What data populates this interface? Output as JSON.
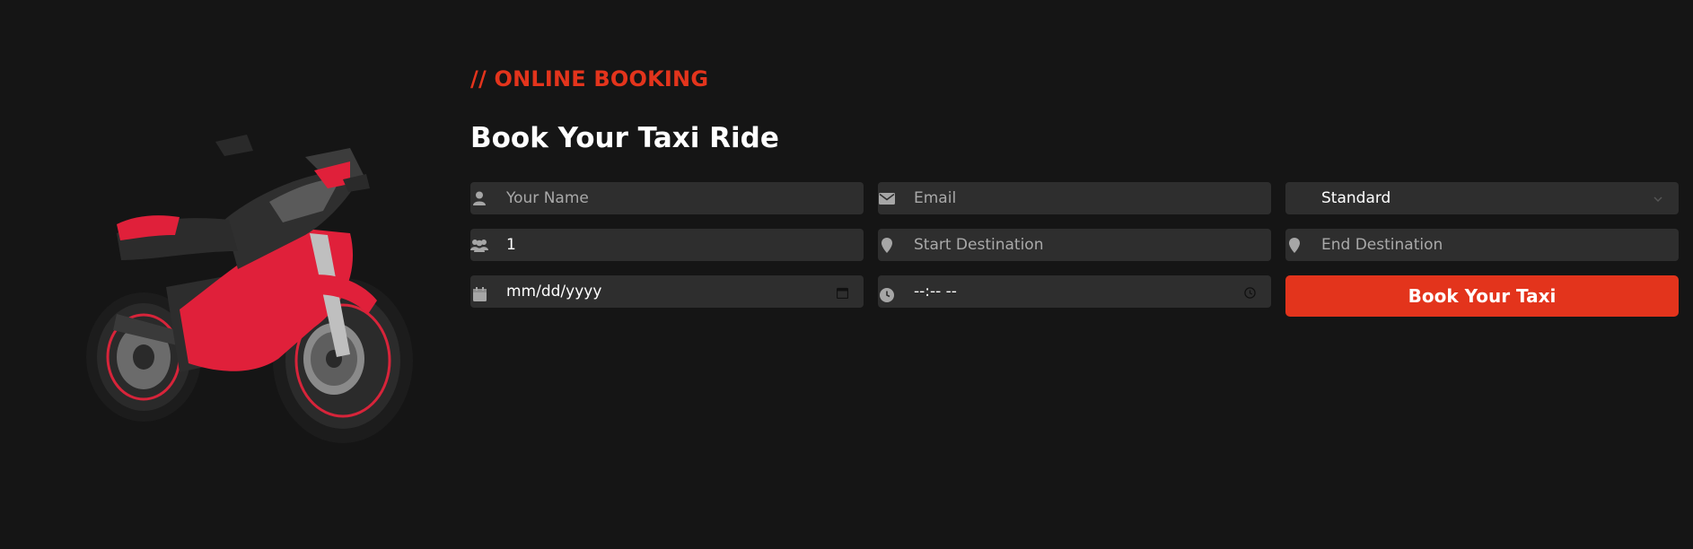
{
  "section": {
    "eyebrow": "// ONLINE BOOKING",
    "title": "Book Your Taxi Ride"
  },
  "form": {
    "name": {
      "placeholder": "Your Name",
      "icon": "user-icon"
    },
    "email": {
      "placeholder": "Email",
      "icon": "envelope-icon"
    },
    "ride_type": {
      "value": "Standard"
    },
    "passengers": {
      "value": "1",
      "icon": "users-icon"
    },
    "start": {
      "placeholder": "Start Destination",
      "icon": "map-pin-icon"
    },
    "end": {
      "placeholder": "End Destination",
      "icon": "map-pin-icon"
    },
    "date": {
      "value": "mm/dd/yyyy",
      "icon": "calendar-icon"
    },
    "time": {
      "value": "--:-- --",
      "icon": "clock-icon"
    },
    "submit_label": "Book Your Taxi"
  },
  "image": {
    "subject": "motorcycle"
  },
  "colors": {
    "background": "#151515",
    "accent": "#e3341c",
    "field_bg": "#2e2e2e",
    "placeholder": "#a9a9a9"
  }
}
